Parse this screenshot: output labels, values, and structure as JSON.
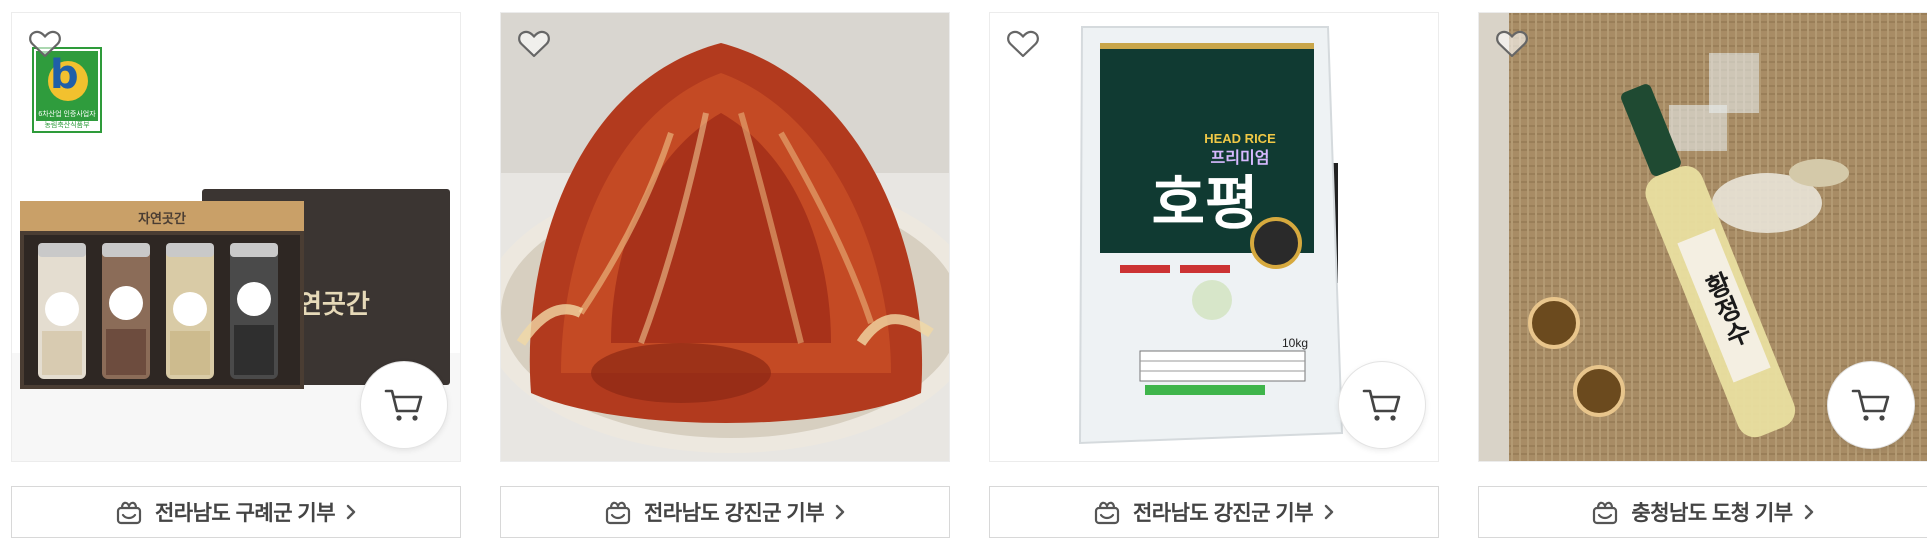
{
  "products": [
    {
      "name": "product-card-1",
      "donation_label": "전라남도 구례군 기부",
      "certification": {
        "line1": "6차산업 인증사업자",
        "line2": "농림축산식품부"
      },
      "image_text": {
        "brand": "자연곳간"
      }
    },
    {
      "name": "product-card-2",
      "donation_label": "전라남도 강진군 기부"
    },
    {
      "name": "product-card-3",
      "donation_label": "전라남도 강진군 기부",
      "image_text": {
        "badge": "HEAD RICE",
        "subtitle": "프리미엄",
        "brand": "호평",
        "weight": "10kg"
      }
    },
    {
      "name": "product-card-4",
      "donation_label": "충청남도 도청 기부",
      "image_text": {
        "brand": "황정수"
      }
    }
  ],
  "icons": {
    "wishlist": "heart-outline-icon",
    "cart": "cart-icon",
    "donation": "gift-hand-icon",
    "chevron": "chevron-right-icon"
  },
  "colors": {
    "border": "#d8d8d8",
    "text": "#444444",
    "icon": "#555555"
  }
}
